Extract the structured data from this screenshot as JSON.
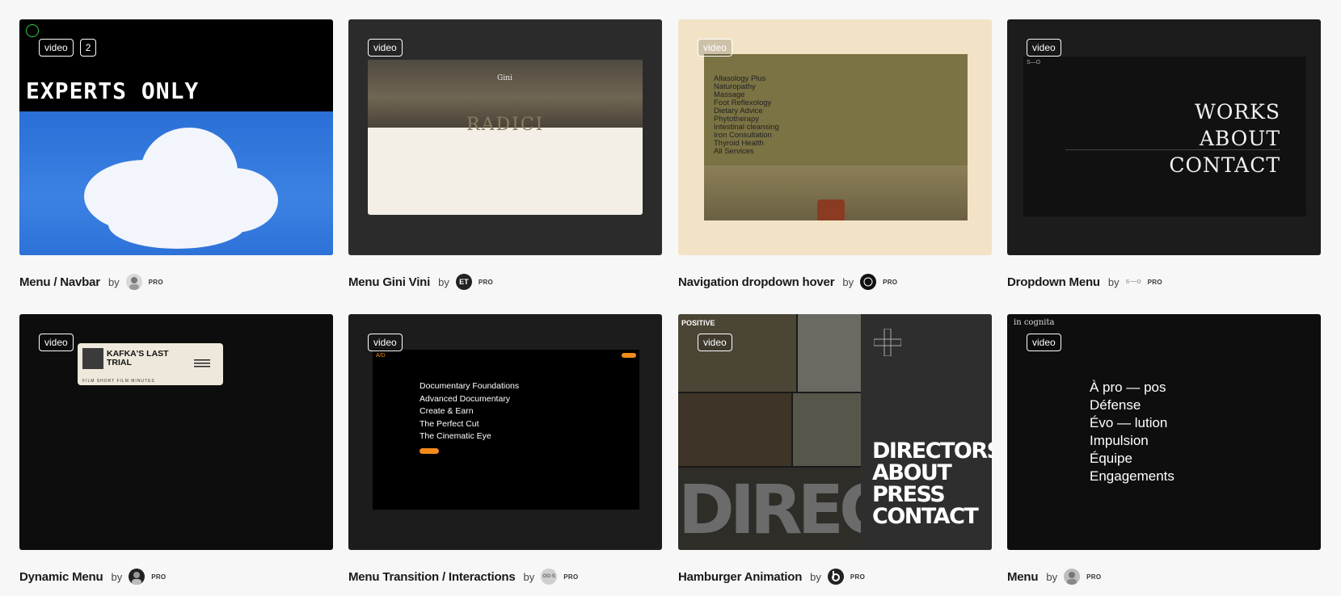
{
  "badge_video": "video",
  "cards": [
    {
      "title": "Menu / Navbar",
      "by": "by",
      "pro": "PRO",
      "badge_count": "2",
      "thumb": {
        "headline": "EXPERTS ONLY"
      }
    },
    {
      "title": "Menu Gini Vini",
      "by": "by",
      "pro": "PRO",
      "avatar_text": "ET",
      "thumb": {
        "brand": "Gini",
        "hero": "RADICI"
      }
    },
    {
      "title": "Navigation dropdown hover",
      "by": "by",
      "pro": "PRO",
      "thumb": {
        "items": [
          "Allasology Plus",
          "Naturopathy",
          "Massage",
          "Foot Reflexology",
          "Dietary Advice",
          "Phytotherapy",
          "Intestinal cleansing",
          "Iron Consultation",
          "Thyroid Health",
          "All Services"
        ]
      }
    },
    {
      "title": "Dropdown Menu",
      "by": "by",
      "pro": "PRO",
      "avatar_text": "s—o",
      "thumb": {
        "items": [
          "WORKS",
          "ABOUT",
          "CONTACT"
        ],
        "logo": "S—O"
      }
    },
    {
      "title": "Dynamic Menu",
      "by": "by",
      "pro": "PRO",
      "thumb": {
        "ticket_title": "KAFKA'S LAST TRIAL",
        "ticket_sub": "FILM  SHORT FILM  MINUTES"
      }
    },
    {
      "title": "Menu Transition / Interactions",
      "by": "by",
      "pro": "PRO",
      "avatar_text": "OO·S",
      "thumb": {
        "logo": "A/D",
        "items": [
          "Documentary Foundations",
          "Advanced Documentary",
          "Create & Earn",
          "The Perfect Cut",
          "The Cinematic Eye"
        ]
      }
    },
    {
      "title": "Hamburger Animation",
      "by": "by",
      "pro": "PRO",
      "thumb": {
        "logo": "POSITIVE",
        "items": [
          "DIRECTORS",
          "ABOUT",
          "PRESS",
          "CONTACT"
        ],
        "bg_word": "DIRECTO"
      }
    },
    {
      "title": "Menu",
      "by": "by",
      "pro": "PRO",
      "thumb": {
        "brand": "in cognita",
        "items": [
          "À pro — pos",
          "Défense",
          "Évo — lution",
          "Impulsion",
          "Équipe",
          "Engagements"
        ]
      }
    }
  ]
}
